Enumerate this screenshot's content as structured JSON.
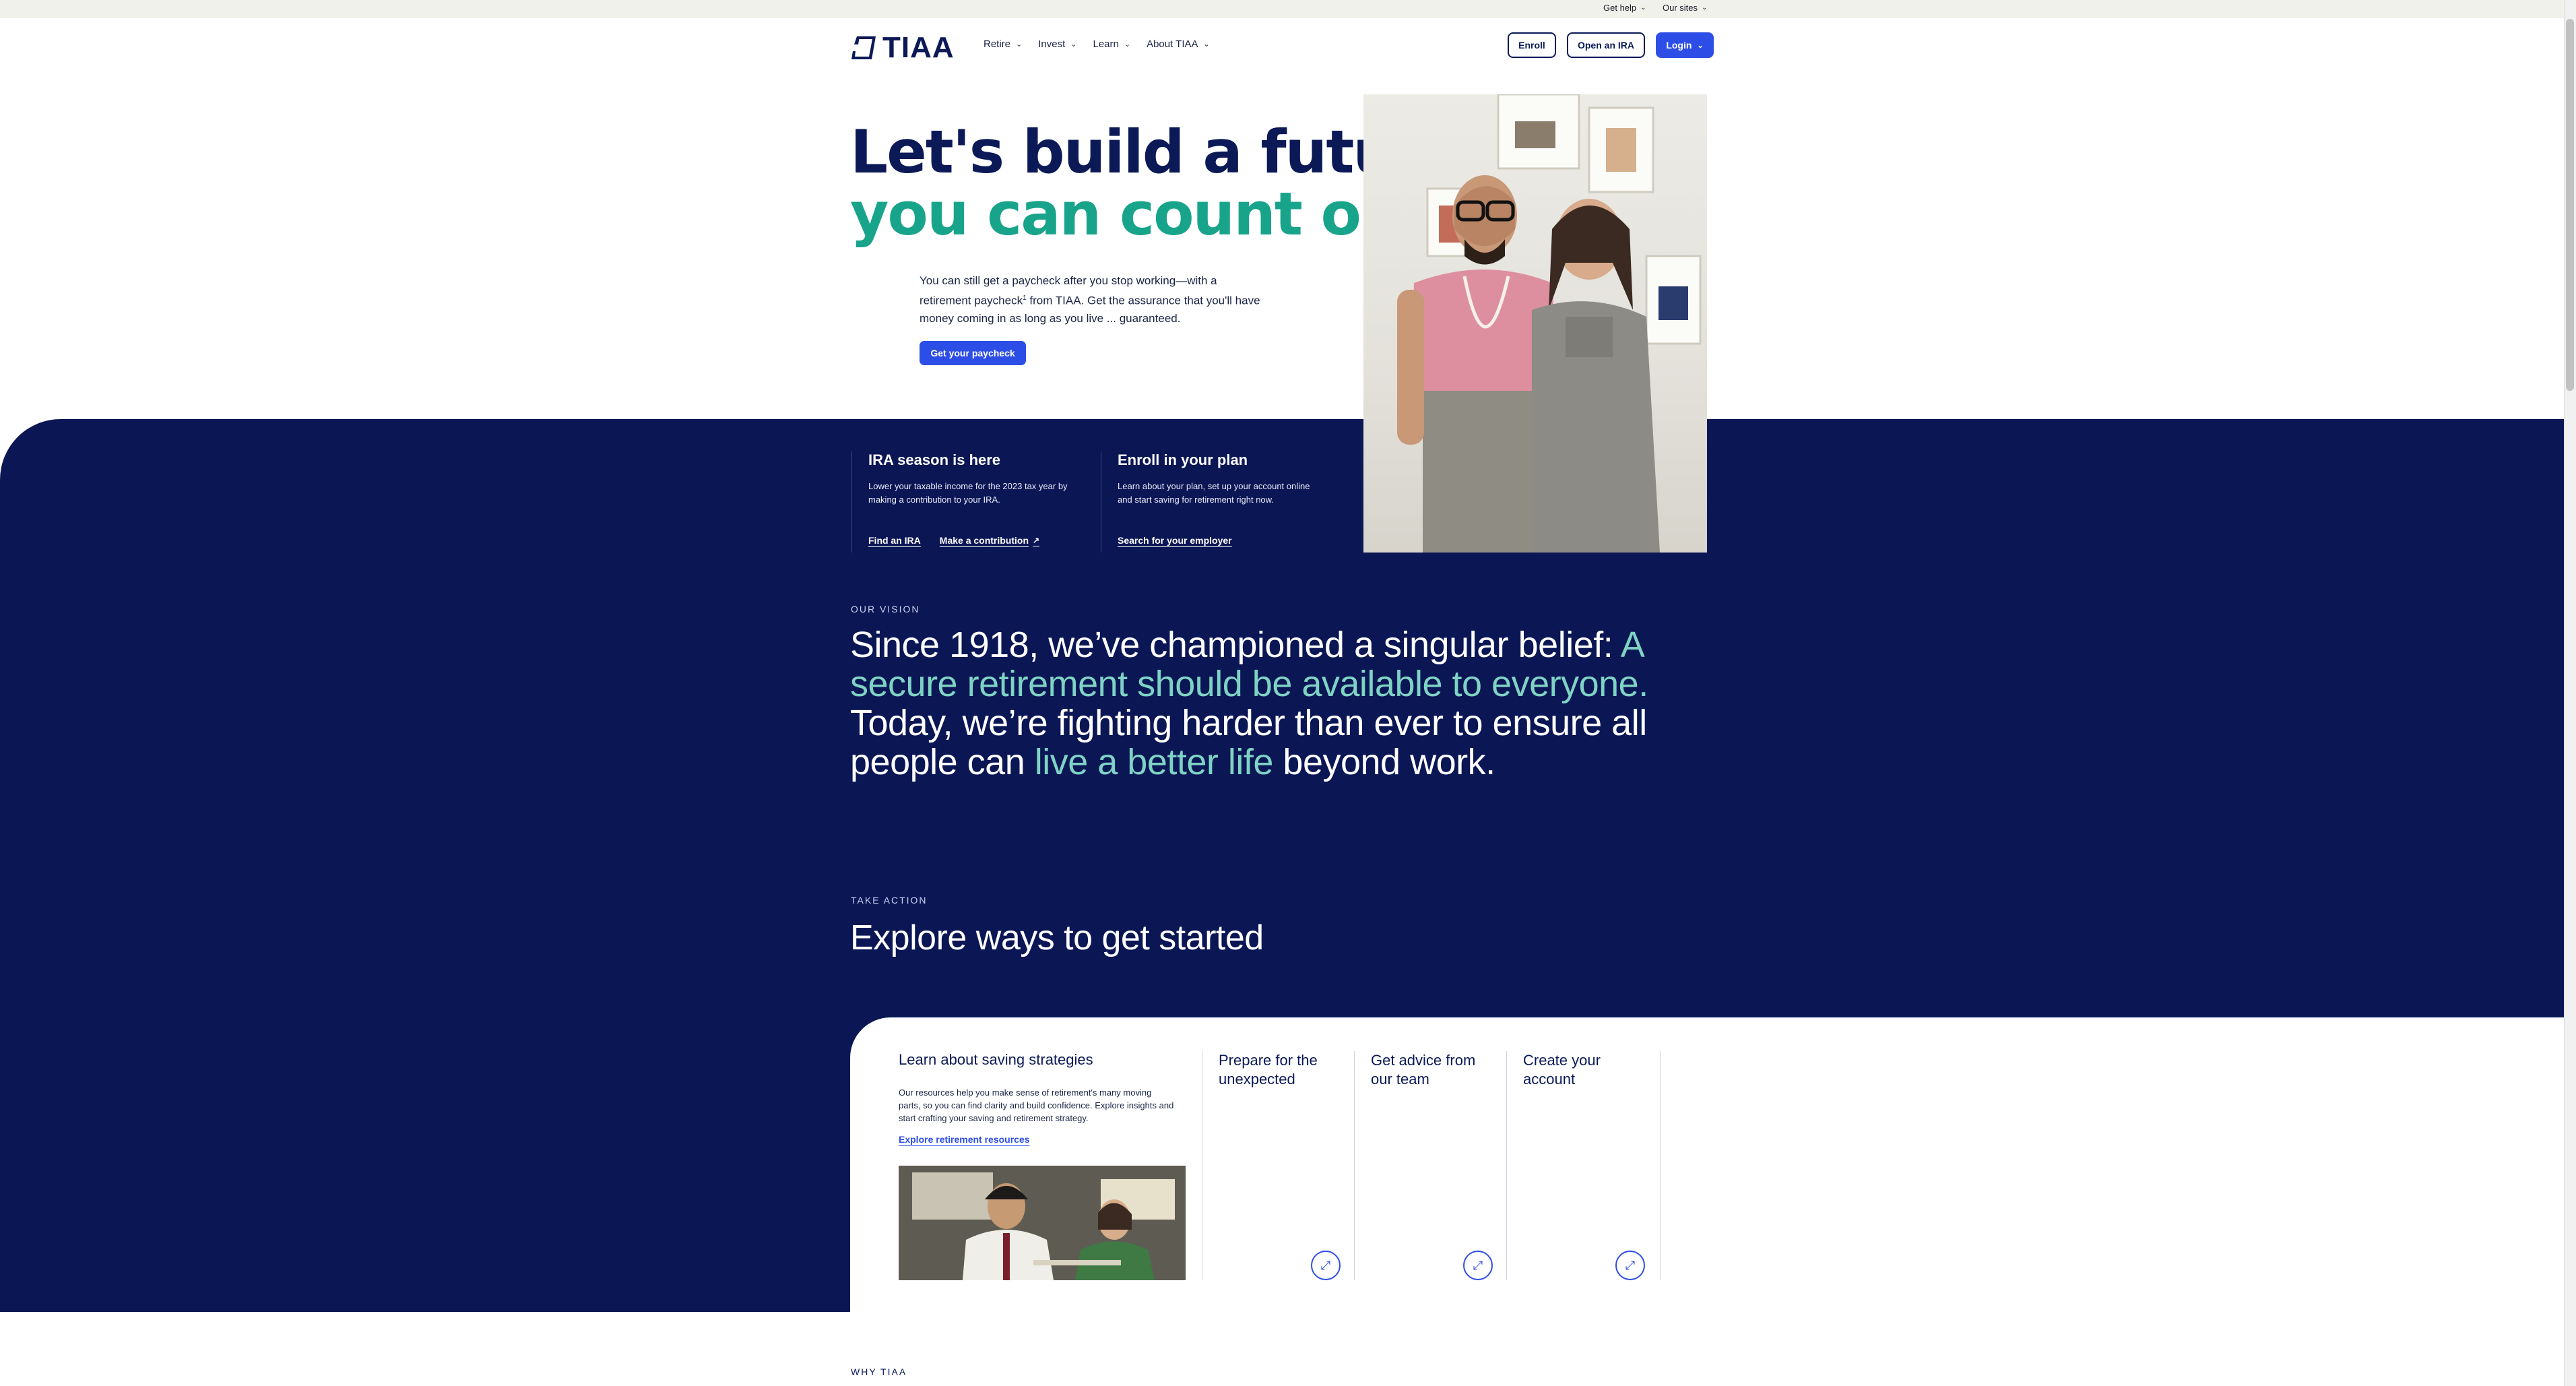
{
  "utility": {
    "get_help": "Get help",
    "our_sites": "Our sites"
  },
  "header": {
    "logo_text": "TIAA",
    "nav": [
      {
        "label": "Retire"
      },
      {
        "label": "Invest"
      },
      {
        "label": "Learn"
      },
      {
        "label": "About TIAA"
      }
    ],
    "enroll": "Enroll",
    "open_ira": "Open an IRA",
    "login": "Login"
  },
  "hero": {
    "line1": "Let's build a future",
    "line2": "you can count on",
    "body_a": "You can still get a paycheck after you stop working—with a retirement paycheck",
    "body_sup": "1",
    "body_b": " from TIAA. Get the assurance that you'll have money coming in as long as you live ... guaranteed.",
    "cta": "Get your paycheck"
  },
  "promo_cards": [
    {
      "title": "IRA season is here",
      "text": "Lower your taxable income for the 2023 tax year by making a contribution to your IRA.",
      "links": [
        "Find an IRA",
        "Make a contribution"
      ]
    },
    {
      "title": "Enroll in your plan",
      "text": "Learn about your plan, set up your account online and start saving for retirement right now.",
      "links": [
        "Search for your employer"
      ]
    }
  ],
  "vision": {
    "eyebrow": "OUR VISION",
    "p1": "Since 1918, we’ve championed a singular belief: ",
    "h1": "A secure retirement should be available to everyone.",
    "p2": " Today, we’re fighting harder than ever to ensure all people can ",
    "h2": "live a better life",
    "p3": " beyond work."
  },
  "take_action": {
    "eyebrow": "TAKE ACTION",
    "heading": "Explore ways to get started",
    "main_tile": {
      "title": "Learn about saving strategies",
      "text": "Our resources help you make sense of retirement's many moving parts, so you can find clarity and build confidence. Explore insights and start crafting your saving and retirement strategy.",
      "link": "Explore retirement resources"
    },
    "tiles": [
      {
        "title": "Prepare for the unexpected"
      },
      {
        "title": "Get advice from our team"
      },
      {
        "title": "Create your account"
      }
    ]
  },
  "why": {
    "eyebrow": "WHY TIAA"
  },
  "colors": {
    "navy": "#0b1655",
    "accent_green": "#18a48b",
    "highlight_mint": "#7fd3c4",
    "primary_blue": "#2d4ee6"
  }
}
